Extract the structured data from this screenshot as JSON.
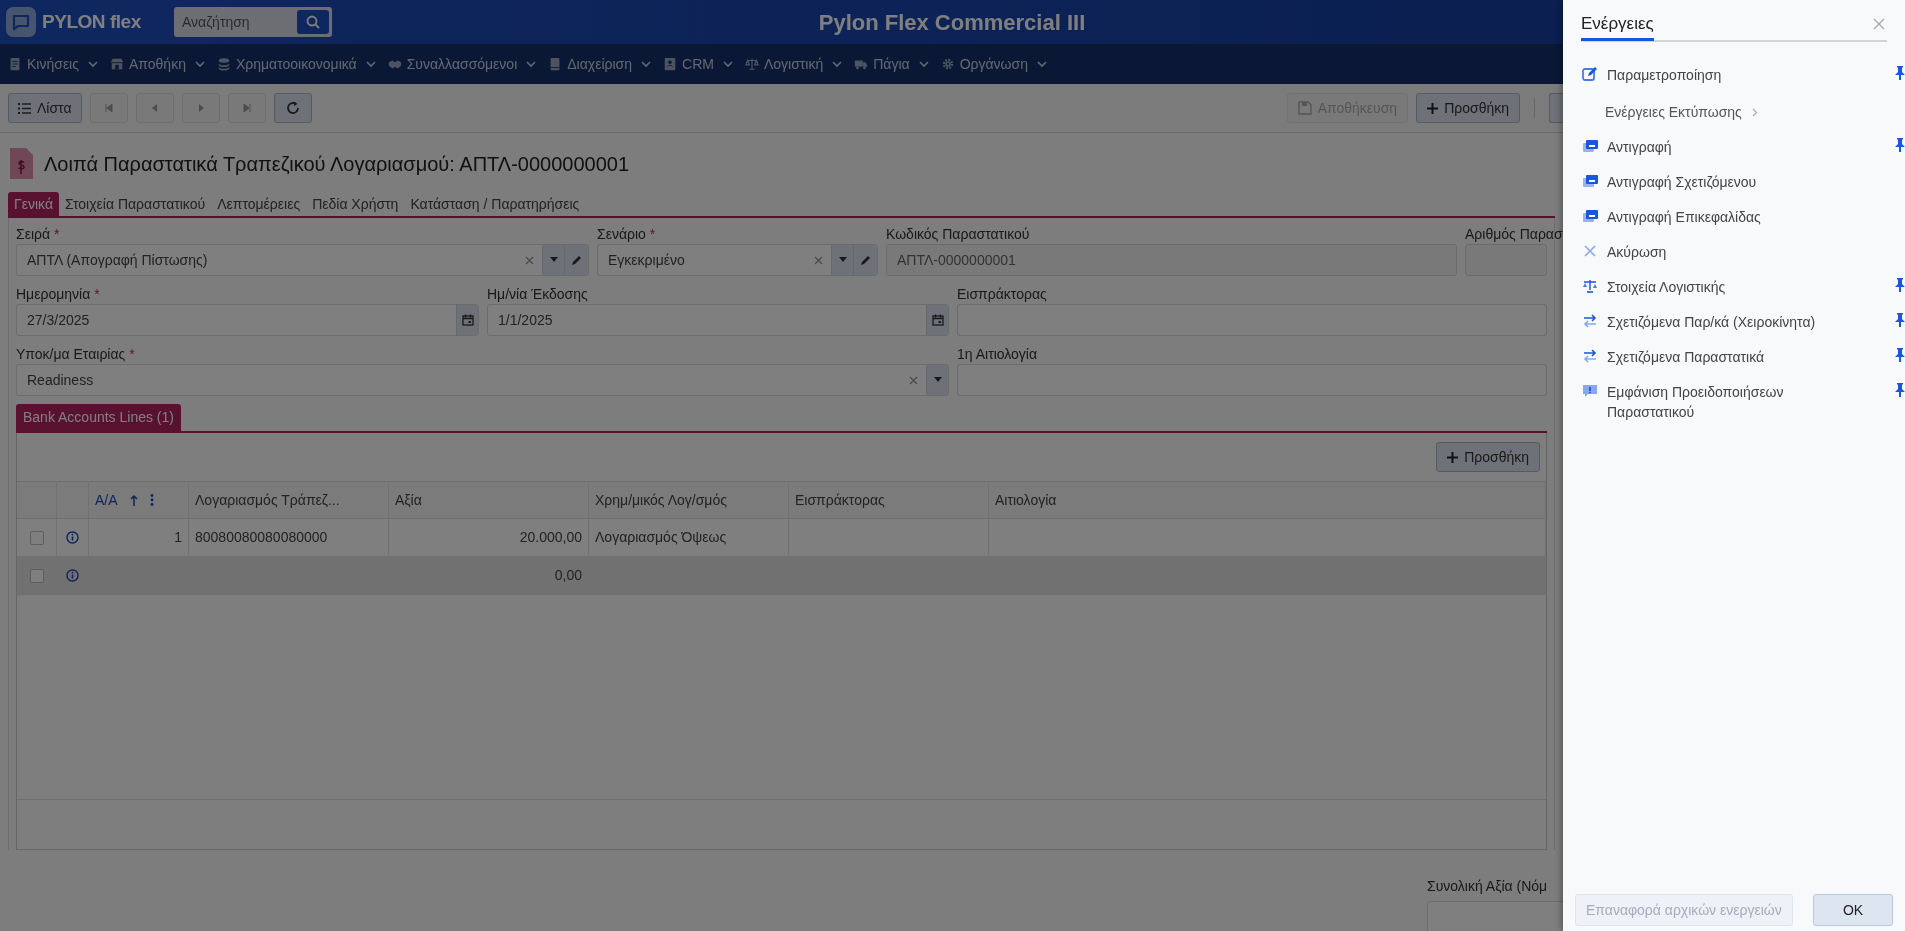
{
  "header": {
    "logo": "PYLON flex",
    "search_placeholder": "Αναζήτηση",
    "app_title": "Pylon Flex Commercial III"
  },
  "menu": [
    {
      "label": "Κινήσεις"
    },
    {
      "label": "Αποθήκη"
    },
    {
      "label": "Χρηματοοικονομικά"
    },
    {
      "label": "Συναλλασσόμενοι"
    },
    {
      "label": "Διαχείριση"
    },
    {
      "label": "CRM"
    },
    {
      "label": "Λογιστική"
    },
    {
      "label": "Πάγια"
    },
    {
      "label": "Οργάνωση"
    }
  ],
  "toolbar": {
    "list_button": "Λίστα",
    "save_button": {
      "label": "Αποθήκευση",
      "disabled": true
    },
    "add_button": "Προσθήκη"
  },
  "document": {
    "title": "Λοιπά Παραστατικά Τραπεζικού Λογαριασμού: ΑΠΤΛ-0000000001"
  },
  "tabs": [
    {
      "label": "Γενικά",
      "selected": true
    },
    {
      "label": "Στοιχεία Παραστατικού",
      "selected": false
    },
    {
      "label": "Λεπτομέρειες",
      "selected": false
    },
    {
      "label": "Πεδία Χρήστη",
      "selected": false
    },
    {
      "label": "Κατάσταση / Παρατηρήσεις",
      "selected": false
    }
  ],
  "form_rows": [
    [
      {
        "label": "Σειρά",
        "required_mark": "*",
        "value": "ΑΠΤΛ (Απογραφή Πίστωσης)",
        "kind": "lookup"
      },
      {
        "label": "Σενάριο",
        "required_mark": "*",
        "value": "Εγκεκριμένο",
        "kind": "lookup"
      },
      {
        "label": "Κωδικός Παραστατικού",
        "value": "ΑΠΤΛ-0000000001",
        "kind": "readonly"
      },
      {
        "label": "Αριθμός Παρασ",
        "kind": "readonly"
      }
    ],
    [
      {
        "label": "Ημερομηνία",
        "required_mark": "*",
        "value": "27/3/2025",
        "kind": "date"
      },
      {
        "label": "Ημ/νία Έκδοσης",
        "value": "1/1/2025",
        "kind": "date"
      },
      {
        "label": "Εισπράκτορας",
        "kind": "text"
      }
    ],
    [
      {
        "label": "Υποκ/μα Εταιρίας",
        "required_mark": "*",
        "value": "Readiness",
        "kind": "select"
      },
      {
        "label": "1η Αιτιολογία",
        "kind": "text"
      }
    ]
  ],
  "subtabs": [
    {
      "label": "Bank Accounts Lines (1)",
      "selected": true
    }
  ],
  "table": {
    "add_button": "Προσθήκη",
    "columns": [
      "Α/Α",
      "Λογαριασμός Τράπεζ...",
      "Αξία",
      "Χρημ/μικός Λογ/σμός",
      "Εισπράκτορας",
      "Αιτιολογία"
    ],
    "rows": [
      {
        "checked": false,
        "new": false,
        "cells": [
          "1",
          "80080080080080000",
          "20.000,00",
          "Λογαριασμός Όψεως",
          "",
          ""
        ]
      },
      {
        "checked": false,
        "new": true,
        "cells": [
          "",
          "",
          "0,00",
          "",
          "",
          ""
        ]
      }
    ]
  },
  "totals": {
    "label": "Συνολική Αξία (Νόμ"
  },
  "actions_panel": {
    "title": "Ενέργειες",
    "items": [
      {
        "label": "Παραμετροποίηση",
        "kind": "action",
        "pinned": true
      },
      {
        "label": "Ενέργειες Εκτύπωσης",
        "kind": "submenu",
        "pinned": false
      },
      {
        "label": "Αντιγραφή",
        "kind": "action",
        "pinned": true
      },
      {
        "label": "Αντιγραφή Σχετιζόμενου",
        "kind": "action",
        "pinned": false
      },
      {
        "label": "Αντιγραφή Επικεφαλίδας",
        "kind": "action",
        "pinned": false
      },
      {
        "label": "Ακύρωση",
        "kind": "action",
        "pinned": false
      },
      {
        "label": "Στοιχεία Λογιστικής",
        "kind": "action",
        "pinned": true
      },
      {
        "label": "Σχετιζόμενα Παρ/κά (Χειροκίνητα)",
        "kind": "action",
        "pinned": true
      },
      {
        "label": "Σχετιζόμενα Παραστατικά",
        "kind": "action",
        "pinned": true
      },
      {
        "label": "Εμφάνιση Προειδοποιήσεων Παραστατικού",
        "kind": "action",
        "pinned": true
      }
    ],
    "reset_button": {
      "label": "Επαναφορά αρχικών ενεργειών",
      "disabled": true
    },
    "ok_button": "OK"
  }
}
